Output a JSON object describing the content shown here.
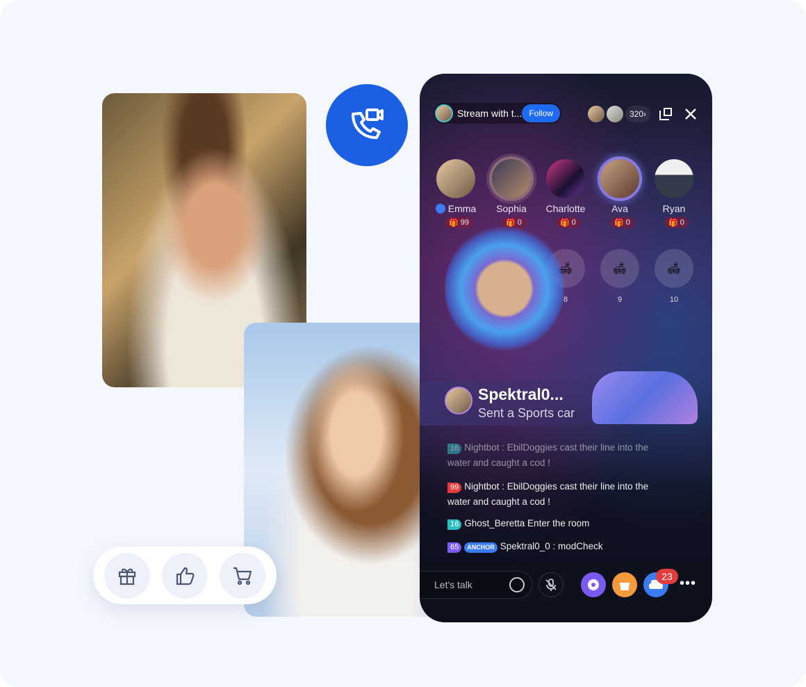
{
  "colors": {
    "accent": "#1b5fe3",
    "background": "#f4f7fd",
    "follow": "#1f6bf0",
    "badge": "#e23b3b"
  },
  "call_button": {
    "icon": "video-call-icon"
  },
  "actions": [
    {
      "icon": "gift-icon"
    },
    {
      "icon": "thumbs-up-icon"
    },
    {
      "icon": "cart-icon"
    }
  ],
  "room": {
    "title": "Stream with t...",
    "follow_label": "Follow",
    "viewer_count": "320",
    "seats": [
      {
        "name": "Emma",
        "gifts": "99"
      },
      {
        "name": "Sophia",
        "gifts": "0"
      },
      {
        "name": "Charlotte",
        "gifts": "0"
      },
      {
        "name": "Ava",
        "gifts": "0"
      },
      {
        "name": "Ryan",
        "gifts": "0"
      }
    ],
    "empty_seats": [
      "8",
      "9",
      "10"
    ],
    "gift_banner": {
      "name": "Spektral0...",
      "text": "Sent a Sports car"
    },
    "chat": [
      {
        "level": "16",
        "text": "Nightbot : EbilDoggies cast their line into the water and caught a cod !"
      },
      {
        "level": "99",
        "text": "Nightbot : EbilDoggies cast their line into the water and caught a cod !"
      },
      {
        "level": "16",
        "text": "Ghost_Beretta Enter the room"
      },
      {
        "level": "65",
        "tag": "ANCHOR",
        "text": "Spektral0_0 : modCheck"
      }
    ],
    "input_placeholder": "Let's talk",
    "seat_badge": "23"
  }
}
